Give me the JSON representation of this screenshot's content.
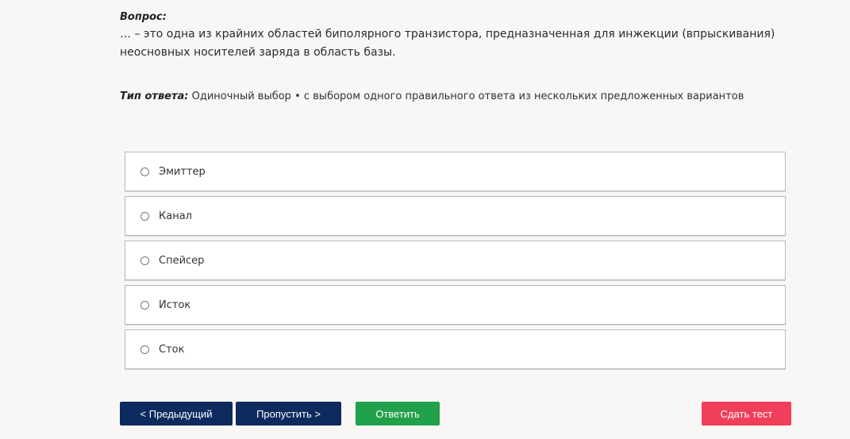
{
  "question": {
    "label": "Вопрос:",
    "text": "… – это одна из крайних областей биполярного транзистора, предназначенная для инжекции (впрыскивания) неосновных носителей заряда в область базы."
  },
  "answer_type": {
    "label": "Тип ответа:",
    "value": "Одиночный выбор • с выбором одного правильного ответа из нескольких предложенных вариантов"
  },
  "options": [
    {
      "label": "Эмиттер"
    },
    {
      "label": "Канал"
    },
    {
      "label": "Спейсер"
    },
    {
      "label": "Исток"
    },
    {
      "label": "Сток"
    }
  ],
  "buttons": {
    "prev": "< Предыдущий",
    "skip": "Пропустить >",
    "answer": "Ответить",
    "submit": "Сдать тест"
  },
  "colors": {
    "nav_button": "#0d2b5e",
    "answer_button": "#21a04a",
    "submit_button": "#ef3f5a",
    "background": "#f8f7f6"
  }
}
